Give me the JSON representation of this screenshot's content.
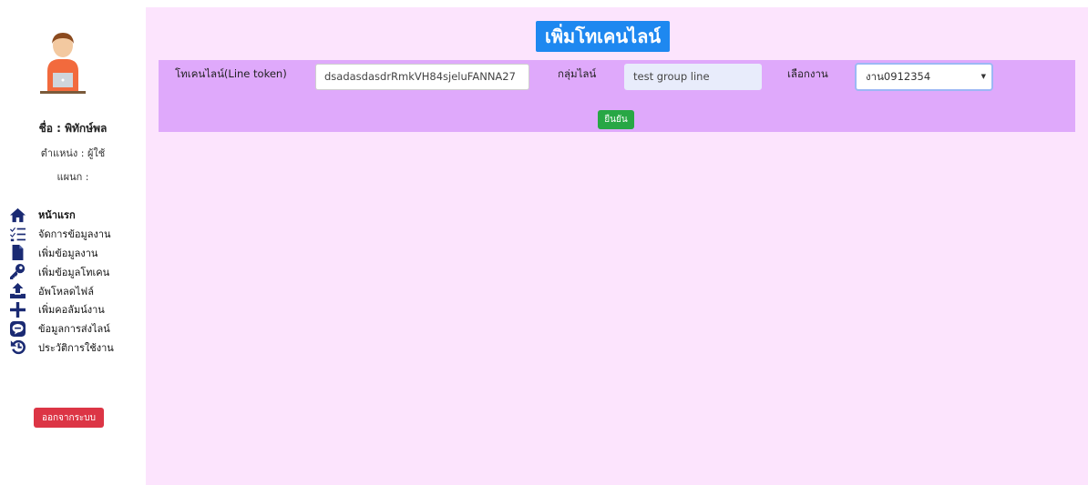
{
  "sidebar": {
    "user_name": "ชื่อ : พิทักษ์พล",
    "user_role": "ตำแหน่ง : ผู้ใช้",
    "user_dept": "แผนก :",
    "items": [
      {
        "label": "หน้าแรก",
        "icon": "home-icon"
      },
      {
        "label": "จัดการข้อมูลงาน",
        "icon": "list-check-icon"
      },
      {
        "label": "เพิ่มข้อมูลงาน",
        "icon": "file-icon"
      },
      {
        "label": "เพิ่มข้อมูลโทเคน",
        "icon": "key-icon"
      },
      {
        "label": "อัพโหลดไฟล์",
        "icon": "upload-icon"
      },
      {
        "label": "เพิ่มคอลัมน์งาน",
        "icon": "plus-icon"
      },
      {
        "label": "ข้อมูลการส่งไลน์",
        "icon": "line-chat-icon"
      },
      {
        "label": "ประวัติการใช้งาน",
        "icon": "history-icon"
      }
    ],
    "logout_label": "ออกจากระบบ"
  },
  "main": {
    "title": "เพิ่มโทเคนไลน์",
    "form": {
      "token_label": "โทเคนไลน์(Line token)",
      "token_value": "dsadasdasdrRmkVH84sjeluFANNA27",
      "group_label": "กลุ่มไลน์",
      "group_value": "test group line",
      "job_label": "เลือกงาน",
      "job_value": "งาน0912354",
      "confirm_label": "ยืนยัน"
    }
  },
  "colors": {
    "main_bg": "#fce4fd",
    "form_bg": "#dfa9fb",
    "title_bg": "#1e88f0",
    "confirm_bg": "#28a745",
    "logout_bg": "#dc3545",
    "icon": "#1a2a73"
  }
}
